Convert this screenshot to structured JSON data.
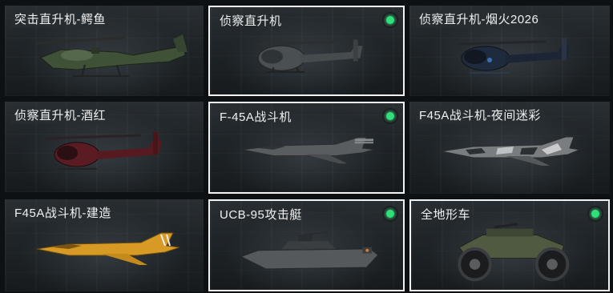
{
  "cards": [
    {
      "name": "突击直升机-鳄鱼",
      "selected": false,
      "kind": "attack-helicopter",
      "color": "#3f5238"
    },
    {
      "name": "侦察直升机",
      "selected": true,
      "kind": "scout-helicopter",
      "color": "#4a4f52"
    },
    {
      "name": "侦察直升机-烟火2026",
      "selected": false,
      "kind": "scout-helicopter",
      "color": "#1e2b3f"
    },
    {
      "name": "侦察直升机-酒红",
      "selected": false,
      "kind": "scout-helicopter",
      "color": "#5a1c22"
    },
    {
      "name": "F-45A战斗机",
      "selected": true,
      "kind": "fighter-jet",
      "color": "#5a5d60"
    },
    {
      "name": "F45A战斗机-夜间迷彩",
      "selected": false,
      "kind": "fighter-jet-camo",
      "color": "#6b6e72"
    },
    {
      "name": "F45A战斗机-建造",
      "selected": false,
      "kind": "fighter-jet",
      "color": "#d79a24"
    },
    {
      "name": "UCB-95攻击艇",
      "selected": true,
      "kind": "attack-boat",
      "color": "#55595c"
    },
    {
      "name": "全地形车",
      "selected": true,
      "kind": "atv",
      "color": "#4f5a40"
    }
  ]
}
